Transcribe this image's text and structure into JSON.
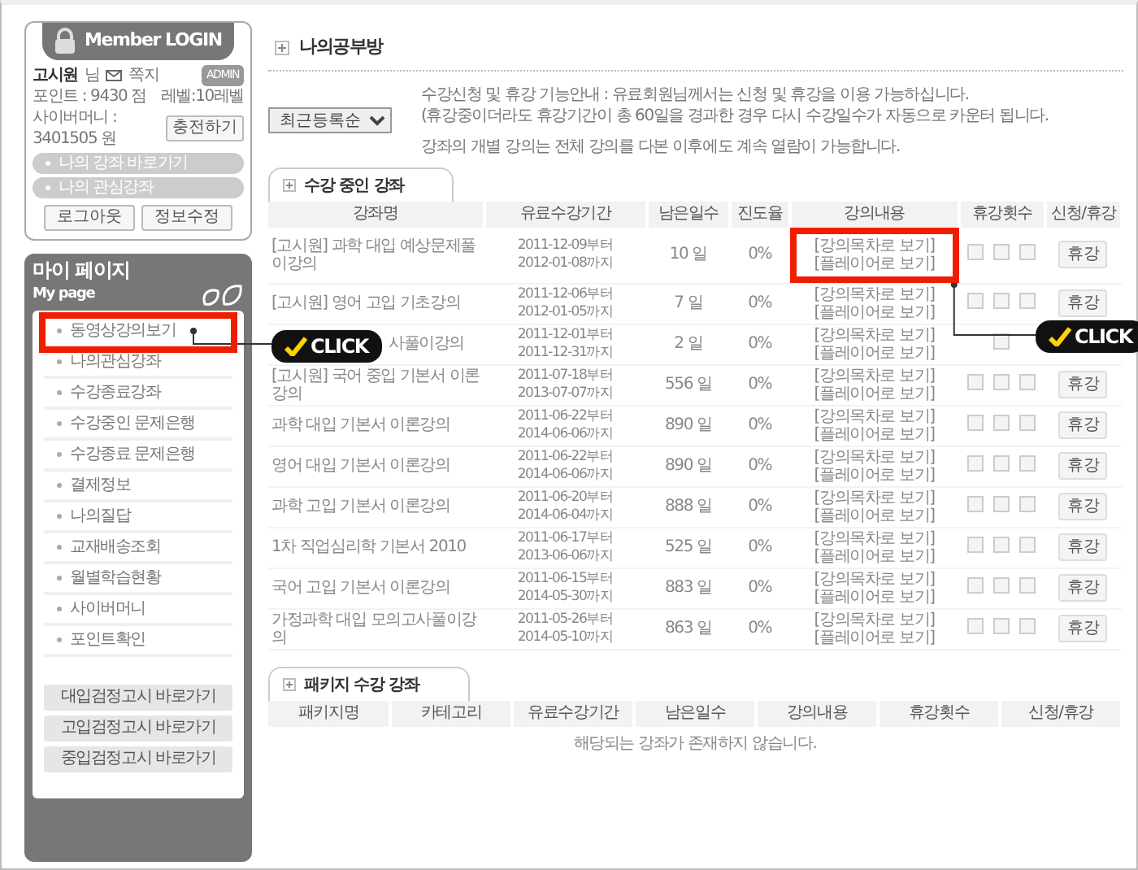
{
  "login": {
    "title": "Member LOGIN",
    "user": "고시원",
    "honorific": "님",
    "message_label": "쪽지",
    "role_badge": "ADMIN",
    "points": "포인트 : 9430 점",
    "level": "레벨:10레벨",
    "cyber_money": "사이버머니 : 3401505 원",
    "charge_button": "충전하기",
    "shortcuts": [
      "나의 강좌 바로가기",
      "나의 관심강좌"
    ],
    "buttons": [
      "로그아웃",
      "정보수정"
    ]
  },
  "mypage": {
    "title": "마이 페이지",
    "subtitle": "My page",
    "items": [
      {
        "label": "동영상강의보기",
        "highlighted": true
      },
      {
        "label": "나의관심강좌",
        "highlighted": false
      },
      {
        "label": "수강종료강좌",
        "highlighted": false
      },
      {
        "label": "수강중인 문제은행",
        "highlighted": false
      },
      {
        "label": "수강종료 문제은행",
        "highlighted": false
      },
      {
        "label": "결제정보",
        "highlighted": false
      },
      {
        "label": "나의질답",
        "highlighted": false
      },
      {
        "label": "교재배송조회",
        "highlighted": false
      },
      {
        "label": "월별학습현황",
        "highlighted": false
      },
      {
        "label": "사이버머니",
        "highlighted": false
      },
      {
        "label": "포인트확인",
        "highlighted": false
      }
    ],
    "shortcut_buttons": [
      "대입검정고시 바로가기",
      "고입검정고시 바로가기",
      "중입검정고시 바로가기"
    ]
  },
  "main": {
    "title": "나의공부방",
    "sort_select": "최근등록순",
    "notice": [
      "수강신청 및 휴강 기능안내 : 유료회원님께서는 신청 및 휴강을 이용 가능하십니다.",
      "(휴강중이더라도 휴강기간이 총 60일을 경과한 경우 다시 수강일수가 자동으로 카운터 됩니다.",
      "강좌의 개별 강의는 전체 강의를 다본 이후에도 계속 열람이 가능합니다."
    ]
  },
  "courses": {
    "tab": "수강 중인 강좌",
    "columns": [
      "강좌명",
      "유료수강기간",
      "남은일수",
      "진도율",
      "강의내용",
      "휴강횟수",
      "신청/휴강"
    ],
    "rows": [
      {
        "name": "[고시원] 과학 대입 예상문제풀이강의",
        "from": "2011-12-09부터",
        "to": "2012-01-08까지",
        "days": "10 일",
        "progress": "0%",
        "links": [
          "[강의목차로 보기]",
          "[플레이어로 보기]"
        ],
        "checks": [
          false,
          false,
          false
        ],
        "button": "휴강",
        "highlighted": true,
        "covered": false
      },
      {
        "name": "[고시원] 영어 고입 기초강의",
        "from": "2011-12-06부터",
        "to": "2012-01-05까지",
        "days": "7 일",
        "progress": "0%",
        "links": [
          "[강의목차로 보기]",
          "[플레이어로 보기]"
        ],
        "checks": [
          false,
          false,
          false
        ],
        "button": "휴강",
        "highlighted": false,
        "covered": false
      },
      {
        "name": "사풀이강의",
        "from": "2011-12-01부터",
        "to": "2011-12-31까지",
        "days": "2 일",
        "progress": "0%",
        "links": [
          "[강의목차로 보기]",
          "[플레이어로 보기]"
        ],
        "checks": [
          false
        ],
        "highlighted": false,
        "covered": true
      },
      {
        "name": "[고시원] 국어 중입 기본서 이론강의",
        "from": "2011-07-18부터",
        "to": "2013-07-07까지",
        "days": "556 일",
        "progress": "0%",
        "links": [
          "[강의목차로 보기]",
          "[플레이어로 보기]"
        ],
        "checks": [
          false,
          false,
          false
        ],
        "button": "휴강",
        "highlighted": false,
        "covered": false
      },
      {
        "name": "과학 대입 기본서 이론강의",
        "from": "2011-06-22부터",
        "to": "2014-06-06까지",
        "days": "890 일",
        "progress": "0%",
        "links": [
          "[강의목차로 보기]",
          "[플레이어로 보기]"
        ],
        "checks": [
          false,
          false,
          false
        ],
        "button": "휴강",
        "highlighted": false,
        "covered": false
      },
      {
        "name": "영어 대입 기본서 이론강의",
        "from": "2011-06-22부터",
        "to": "2014-06-06까지",
        "days": "890 일",
        "progress": "0%",
        "links": [
          "[강의목차로 보기]",
          "[플레이어로 보기]"
        ],
        "checks": [
          false,
          false,
          false
        ],
        "button": "휴강",
        "highlighted": false,
        "covered": false
      },
      {
        "name": "과학 고입 기본서 이론강의",
        "from": "2011-06-20부터",
        "to": "2014-06-04까지",
        "days": "888 일",
        "progress": "0%",
        "links": [
          "[강의목차로 보기]",
          "[플레이어로 보기]"
        ],
        "checks": [
          false,
          false,
          false
        ],
        "button": "휴강",
        "highlighted": false,
        "covered": false
      },
      {
        "name": "1차 직업심리학 기본서 2010",
        "from": "2011-06-17부터",
        "to": "2013-06-06까지",
        "days": "525 일",
        "progress": "0%",
        "links": [
          "[강의목차로 보기]",
          "[플레이어로 보기]"
        ],
        "checks": [
          false,
          false,
          false
        ],
        "button": "휴강",
        "highlighted": false,
        "covered": false
      },
      {
        "name": "국어 고입 기본서 이론강의",
        "from": "2011-06-15부터",
        "to": "2014-05-30까지",
        "days": "883 일",
        "progress": "0%",
        "links": [
          "[강의목차로 보기]",
          "[플레이어로 보기]"
        ],
        "checks": [
          false,
          false,
          false
        ],
        "button": "휴강",
        "highlighted": false,
        "covered": false
      },
      {
        "name": "가정과학 대입 모의고사풀이강의",
        "from": "2011-05-26부터",
        "to": "2014-05-10까지",
        "days": "863 일",
        "progress": "0%",
        "links": [
          "[강의목차로 보기]",
          "[플레이어로 보기]"
        ],
        "checks": [
          false,
          false,
          false
        ],
        "button": "휴강",
        "highlighted": false,
        "covered": false
      }
    ]
  },
  "packages": {
    "tab": "패키지 수강 강좌",
    "columns": [
      "패키지명",
      "카테고리",
      "유료수강기간",
      "남은일수",
      "강의내용",
      "휴강횟수",
      "신청/휴강"
    ],
    "empty_message": "해당되는 강좌가 존재하지 않습니다."
  },
  "callouts": [
    {
      "label": "CLICK"
    },
    {
      "label": "CLICK"
    }
  ]
}
